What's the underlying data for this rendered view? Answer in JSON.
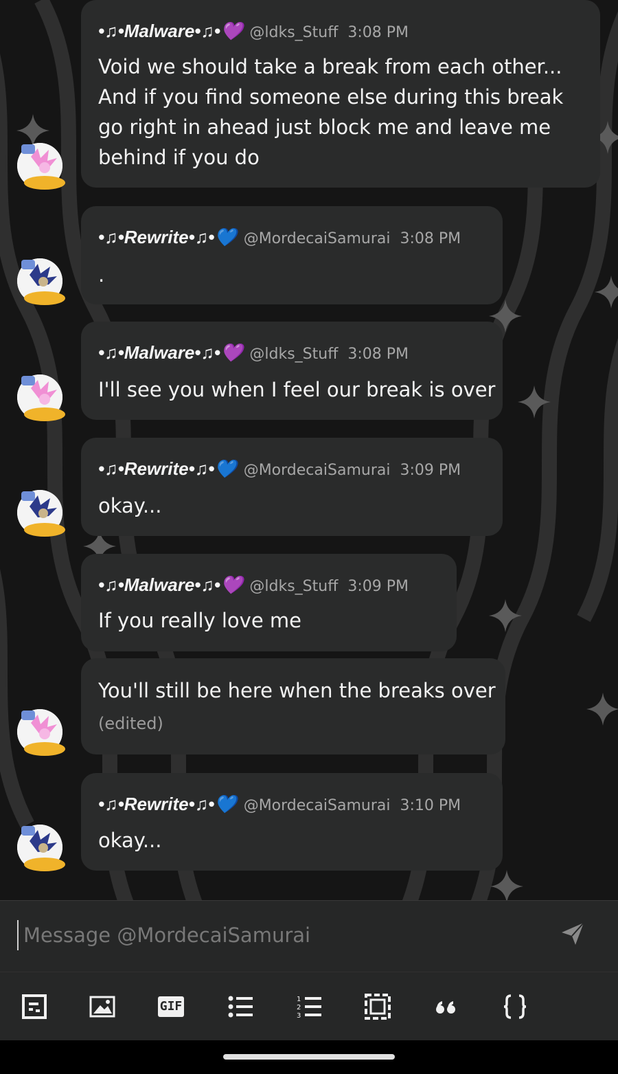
{
  "messages": [
    {
      "name": "•♫•Malware•♫•💜",
      "handle": "@ldks_Stuff",
      "time": "3:08 PM",
      "lines": [
        "Void we should take a break from each other...",
        "And if you find someone else during this break",
        "go right in ahead just block me and leave me",
        "behind if you do"
      ]
    },
    {
      "name": "•♫•Rewrite•♫•💙",
      "handle": "@MordecaiSamurai",
      "time": "3:08 PM",
      "lines": [
        "."
      ]
    },
    {
      "name": "•♫•Malware•♫•💜",
      "handle": "@ldks_Stuff",
      "time": "3:08 PM",
      "lines": [
        "I'll see you when I feel our break is over"
      ]
    },
    {
      "name": "•♫•Rewrite•♫•💙",
      "handle": "@MordecaiSamurai",
      "time": "3:09 PM",
      "lines": [
        "okay..."
      ]
    },
    {
      "name": "•♫•Malware•♫•💜",
      "handle": "@ldks_Stuff",
      "time": "3:09 PM",
      "lines": [
        "If you really love me"
      ]
    },
    {
      "lines": [
        "You'll still be here when the breaks over"
      ],
      "edited": "(edited)"
    },
    {
      "name": "•♫•Rewrite•♫•💙",
      "handle": "@MordecaiSamurai",
      "time": "3:10 PM",
      "lines": [
        "okay..."
      ]
    }
  ],
  "composer": {
    "placeholder": "Message @MordecaiSamurai"
  },
  "toolbar": [
    "spoiler-icon",
    "image-icon",
    "gif-icon",
    "bulleted-list-icon",
    "numbered-list-icon",
    "embed-icon",
    "quote-icon",
    "code-block-icon"
  ],
  "toolbar_gif_label": "GIF",
  "colors": {
    "bubble": "#2a2b2b",
    "background": "#151515",
    "malware_heart": "#a24ee0",
    "rewrite_heart": "#3aa5f2"
  }
}
